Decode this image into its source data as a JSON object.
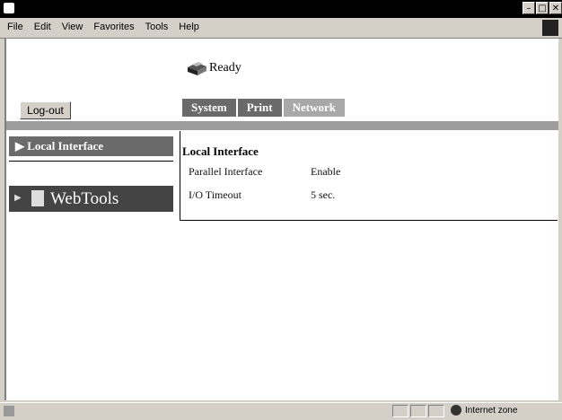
{
  "menu": [
    "File",
    "Edit",
    "View",
    "Favorites",
    "Tools",
    "Help"
  ],
  "status": {
    "text": "Ready"
  },
  "logout_label": "Log-out",
  "tabs": [
    "System",
    "Print",
    "Network"
  ],
  "leftnav": {
    "item": "▶ Local Interface",
    "webtools": "WebTools",
    "webtools_arrow": "▶"
  },
  "section": {
    "title": "Local Interface",
    "rows": [
      {
        "label": "Parallel Interface",
        "value": "Enable"
      },
      {
        "label": "I/O Timeout",
        "value": "5 sec."
      }
    ]
  },
  "statusbar": {
    "zone": "Internet zone"
  },
  "window": {
    "min": "–",
    "restore": "□",
    "close": "✕"
  }
}
